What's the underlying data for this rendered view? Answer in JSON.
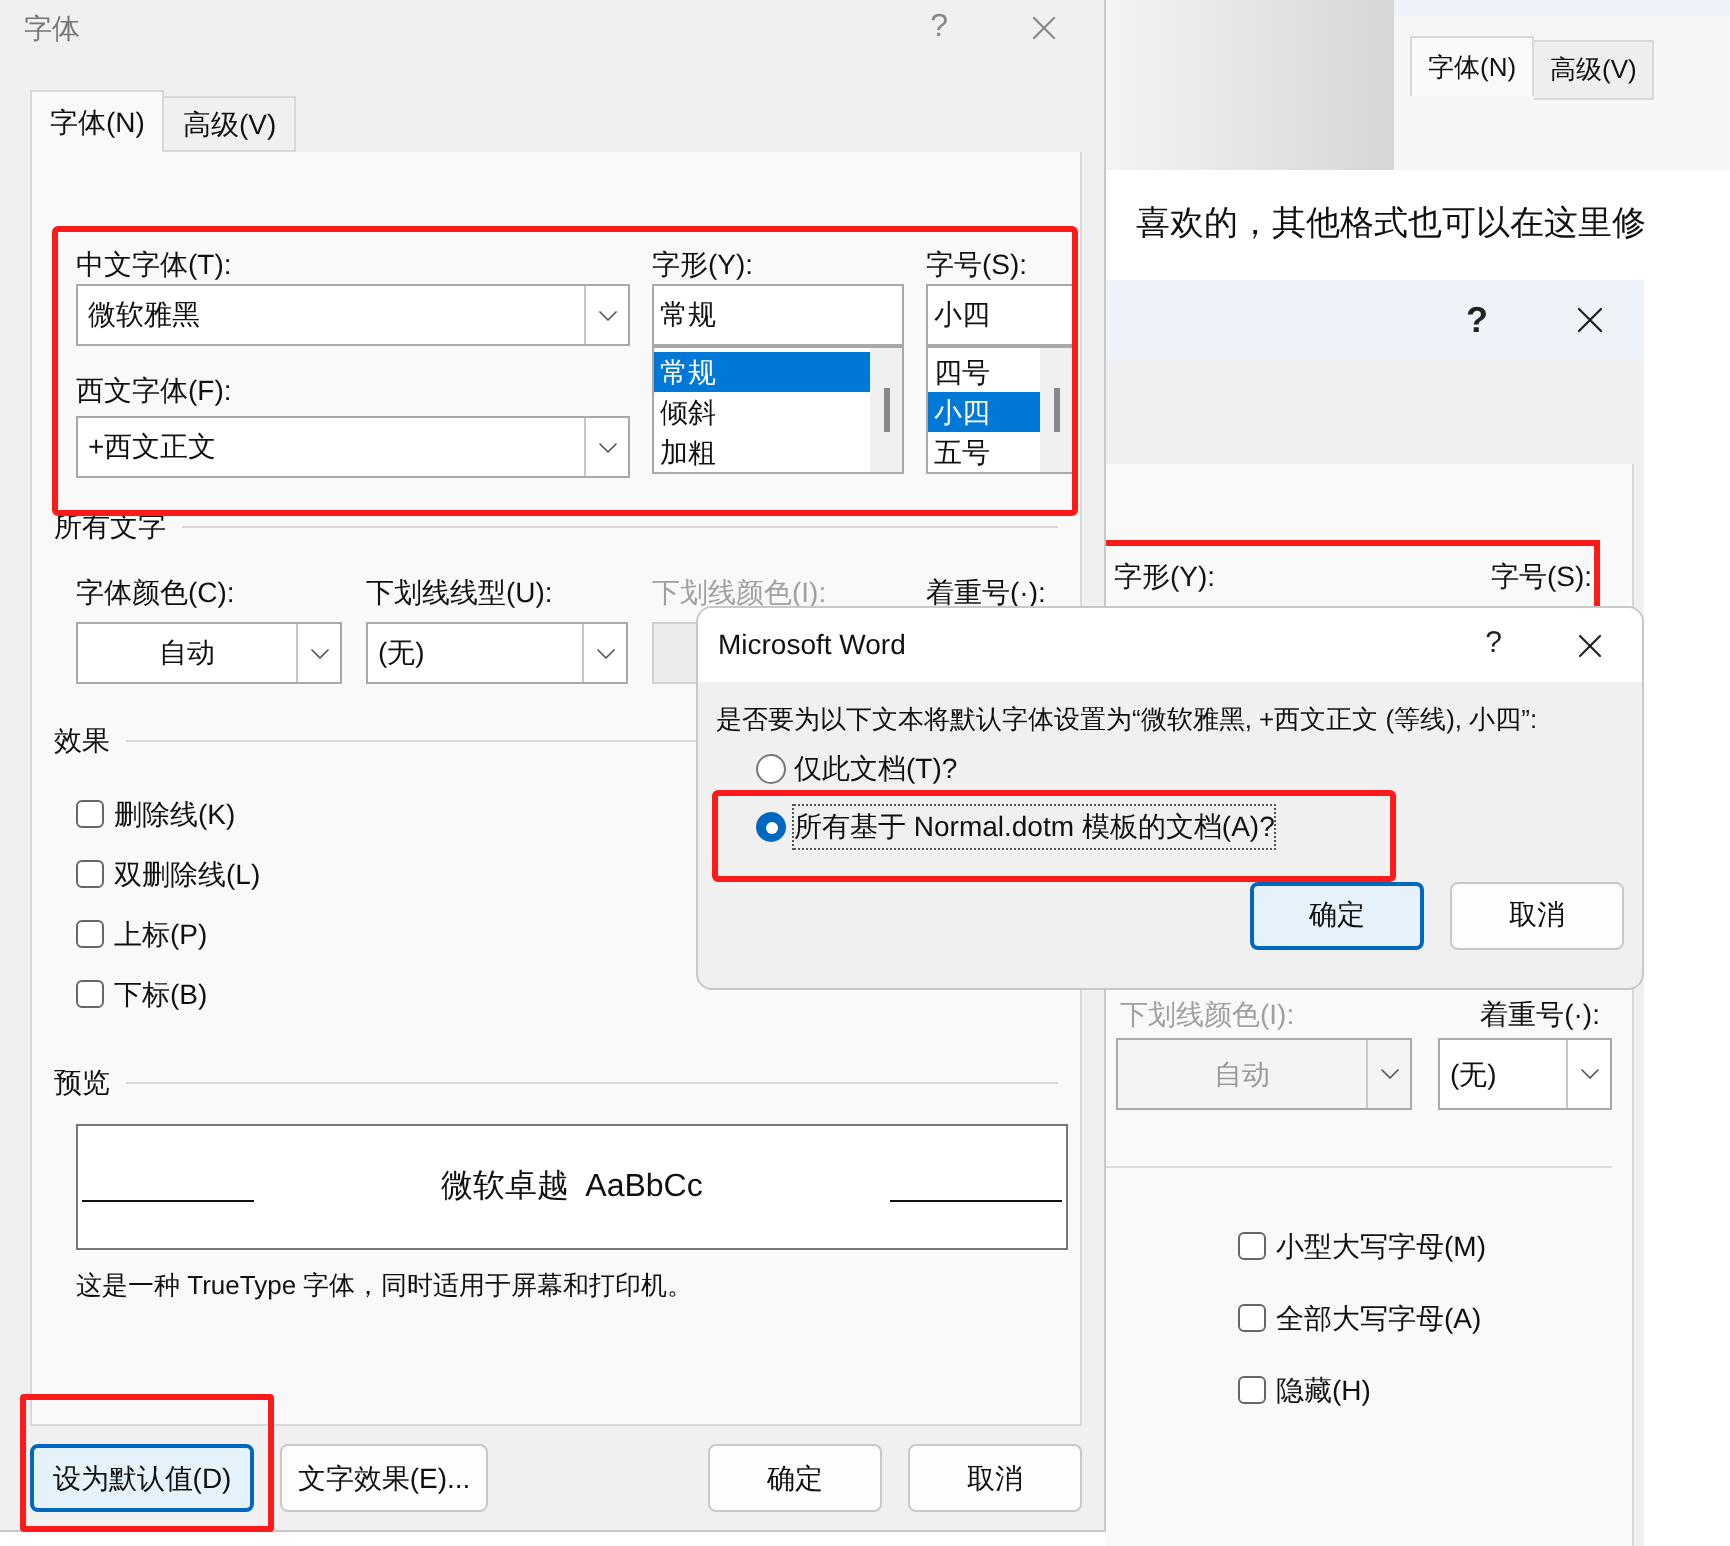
{
  "background_window": {
    "tabs": [
      {
        "label": "字体(N)",
        "selected": true
      },
      {
        "label": "高级(V)",
        "selected": false
      }
    ]
  },
  "document_text": "喜欢的，其他格式也可以在这里修",
  "back_dialog": {
    "help": "?",
    "style_label": "字形(Y):",
    "size_label": "字号(S):",
    "underline_color": {
      "label": "下划线颜色(I):",
      "value": "自动",
      "disabled": true
    },
    "emphasis": {
      "label": "着重号(·):",
      "value": "(无)"
    },
    "checkboxes": [
      {
        "label": "小型大写字母(M)",
        "checked": false
      },
      {
        "label": "全部大写字母(A)",
        "checked": false
      },
      {
        "label": "隐藏(H)",
        "checked": false
      }
    ]
  },
  "font_dialog": {
    "title": "字体",
    "help": "?",
    "tabs": [
      {
        "label": "字体(N)",
        "selected": true
      },
      {
        "label": "高级(V)",
        "selected": false
      }
    ],
    "chinese_font": {
      "label": "中文字体(T):",
      "value": "微软雅黑"
    },
    "western_font": {
      "label": "西文字体(F):",
      "value": "+西文正文"
    },
    "style": {
      "label": "字形(Y):",
      "value": "常规",
      "options": [
        {
          "label": "常规",
          "selected": true
        },
        {
          "label": "倾斜",
          "selected": false
        },
        {
          "label": "加粗",
          "selected": false
        }
      ]
    },
    "size": {
      "label": "字号(S):",
      "value": "小四",
      "options": [
        {
          "label": "四号",
          "selected": false
        },
        {
          "label": "小四",
          "selected": true
        },
        {
          "label": "五号",
          "selected": false
        }
      ]
    },
    "all_text_title": "所有文字",
    "font_color": {
      "label": "字体颜色(C):",
      "value": "自动",
      "disabled": false
    },
    "underline_style": {
      "label": "下划线线型(U):",
      "value": "(无)",
      "disabled": false
    },
    "underline_color": {
      "label": "下划线颜色(I):",
      "disabled": true
    },
    "emphasis": {
      "label": "着重号(·):"
    },
    "effects_title": "效果",
    "effects": [
      {
        "label": "删除线(K)",
        "checked": false
      },
      {
        "label": "双删除线(L)",
        "checked": false
      },
      {
        "label": "上标(P)",
        "checked": false
      },
      {
        "label": "下标(B)",
        "checked": false
      }
    ],
    "preview_title": "预览",
    "preview_chinese": "微软卓越",
    "preview_latin": "AaBbCc",
    "description": "这是一种 TrueType 字体，同时适用于屏幕和打印机。",
    "left_buttons": [
      {
        "label": "设为默认值(D)",
        "focused": true
      },
      {
        "label": "文字效果(E)...",
        "focused": false
      }
    ],
    "right_buttons": [
      {
        "label": "确定",
        "focused": false
      },
      {
        "label": "取消",
        "focused": false
      }
    ]
  },
  "word_dialog": {
    "title": "Microsoft Word",
    "help": "?",
    "message": "是否要为以下文本将默认字体设置为“微软雅黑, +西文正文 (等线), 小四”:",
    "options": [
      {
        "label": "仅此文档(T)?",
        "selected": false
      },
      {
        "label": "所有基于 Normal.dotm 模板的文档(A)?",
        "selected": true
      }
    ],
    "buttons": [
      {
        "label": "确定",
        "focused": true
      },
      {
        "label": "取消",
        "focused": false
      }
    ]
  }
}
